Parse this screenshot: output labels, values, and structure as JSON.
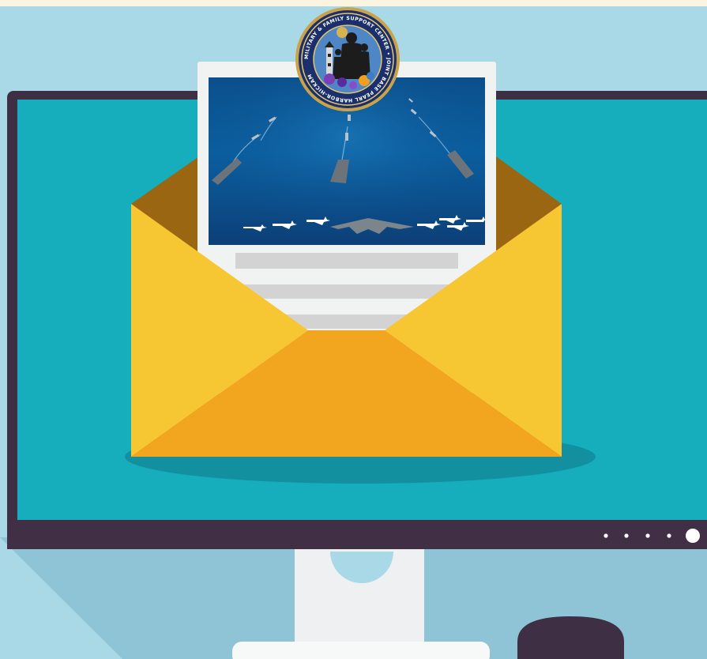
{
  "scene": {
    "subject": "newsletter-email-illustration",
    "colors": {
      "background": "#a9d8e6",
      "shadow": "#8ec4d6",
      "monitor_frame": "#3f2f44",
      "screen": "#16aebd",
      "envelope_back": "#9a6611",
      "envelope_flap": "#f7c633",
      "envelope_front": "#f2a51e",
      "paper": "#f1f2f2",
      "paper_line": "#d3d3d3",
      "stand": "#eef0f1",
      "mouse": "#3f2f44"
    },
    "monitor": {
      "indicator_dots": 4,
      "power_button": "power-button-icon"
    },
    "letter": {
      "photo": "naval-fleet-aerial-photo",
      "text_lines": 3
    },
    "seal": {
      "emblem": "military-family-support-center-seal",
      "text": "MILITARY & FAMILY SUPPORT CENTER • JOINT BASE PEARL HARBOR-HICKAM"
    }
  }
}
